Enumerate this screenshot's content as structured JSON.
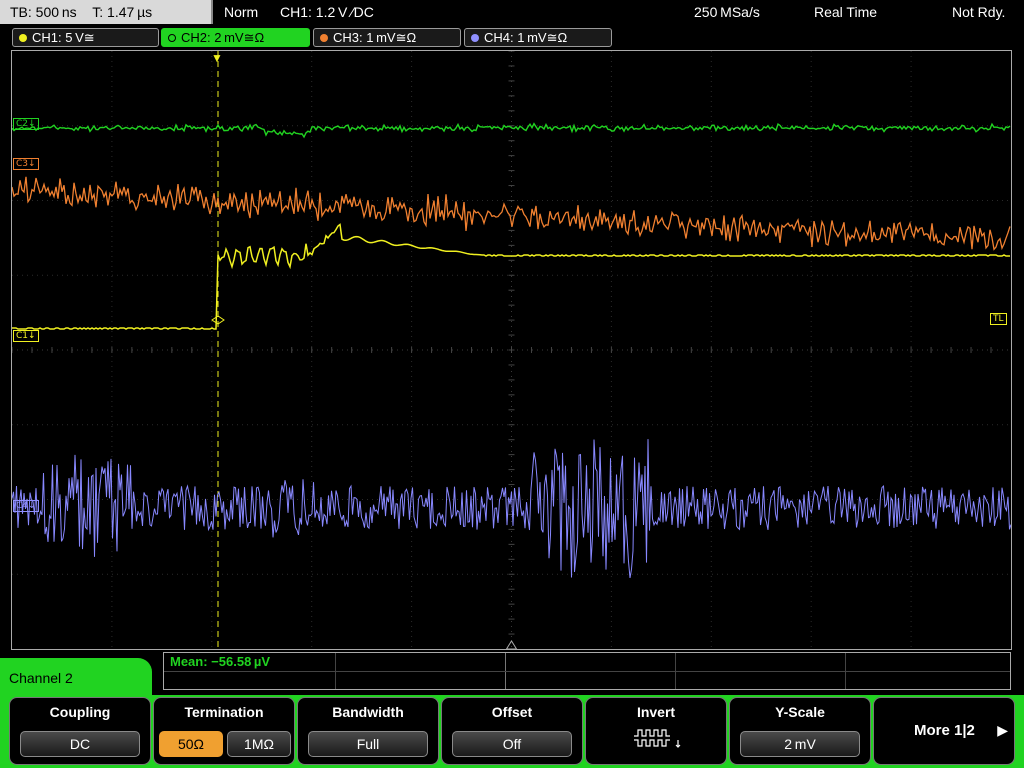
{
  "status": {
    "timebase": "TB: 500 ns",
    "trigger_time": "T: 1.47 µs",
    "trigger_mode": "Norm",
    "trigger_info": "CH1: 1.2 V ∕DC",
    "sample_rate": "250 MSa/s",
    "acq_mode": "Real Time",
    "state": "Not Rdy."
  },
  "channels": [
    {
      "label": "CH1: 5 V≅",
      "color": "#f0f020",
      "active": false
    },
    {
      "label": "CH2: 2 mV≅Ω",
      "color": "#21d321",
      "active": true
    },
    {
      "label": "CH3: 1 mV≅Ω",
      "color": "#f08030",
      "active": false
    },
    {
      "label": "CH4: 1 mV≅Ω",
      "color": "#9090ff",
      "active": false
    }
  ],
  "markers": {
    "c2": "C2↓",
    "c3": "C3↓",
    "c1": "C1↓",
    "c4": "C4↓",
    "tl": "TL"
  },
  "measurement": {
    "text": "Mean: −56.58 µV"
  },
  "menu_title": "Channel 2",
  "softkeys": {
    "coupling": {
      "title": "Coupling",
      "value": "DC"
    },
    "termination": {
      "title": "Termination",
      "options": [
        "50Ω",
        "1MΩ"
      ],
      "selected": "50Ω"
    },
    "bandwidth": {
      "title": "Bandwidth",
      "value": "Full"
    },
    "offset": {
      "title": "Offset",
      "value": "Off"
    },
    "invert": {
      "title": "Invert",
      "icon": "invert-waveform-icon"
    },
    "yscale": {
      "title": "Y-Scale",
      "value": "2 mV"
    },
    "more": {
      "label": "More 1|2",
      "icon": "arrow-right-icon"
    }
  }
}
